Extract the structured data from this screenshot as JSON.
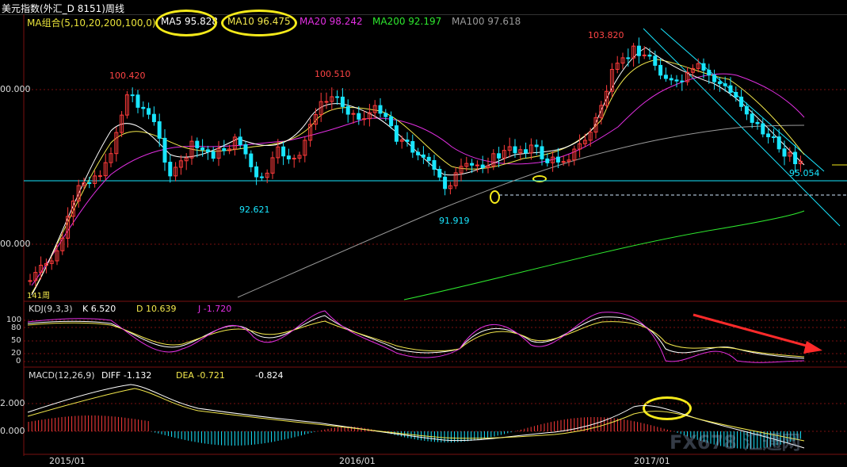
{
  "window": {
    "title": "美元指数(外汇_D 8151)周线"
  },
  "ma_legend": [
    {
      "text": "MA组合(5,10,20,200,100,0)",
      "color": "#e8e23a"
    },
    {
      "text": "MA5 95.828",
      "color": "#ffffff"
    },
    {
      "text": "MA10 96.475",
      "color": "#f3e84c"
    },
    {
      "text": "MA20 98.242",
      "color": "#e22fe2"
    },
    {
      "text": "MA200 92.197",
      "color": "#2ee82e"
    },
    {
      "text": "MA100 97.618",
      "color": "#9a9a9a"
    }
  ],
  "price_axis": {
    "labels": [
      "00.000",
      "00.000"
    ]
  },
  "price_annotations": {
    "high_2015": "100.420",
    "high_2016": "100.510",
    "low_2015": "92.621",
    "low_2016": "91.919",
    "high_2017": "103.820",
    "last": "95.054"
  },
  "period_label": "141周",
  "kdj": {
    "header": "KDJ(9,3,3)",
    "k": "K  6.520",
    "d": "D  10.639",
    "j": "J  -1.720",
    "axis": [
      "100",
      "80",
      "50",
      "20",
      "0"
    ]
  },
  "macd": {
    "header": "MACD(12,26,9)",
    "diff": "DIFF  -1.132",
    "dea": "DEA  -0.721",
    "macd": "-0.824",
    "axis": [
      "2.000",
      "0.000"
    ]
  },
  "time_axis": [
    "2015/01",
    "2016/01",
    "2017/01"
  ],
  "watermark": "FX678 汇通网",
  "colors": {
    "up": "#ff3b3b",
    "down": "#19e6ff",
    "grid": "#7a1010"
  }
}
